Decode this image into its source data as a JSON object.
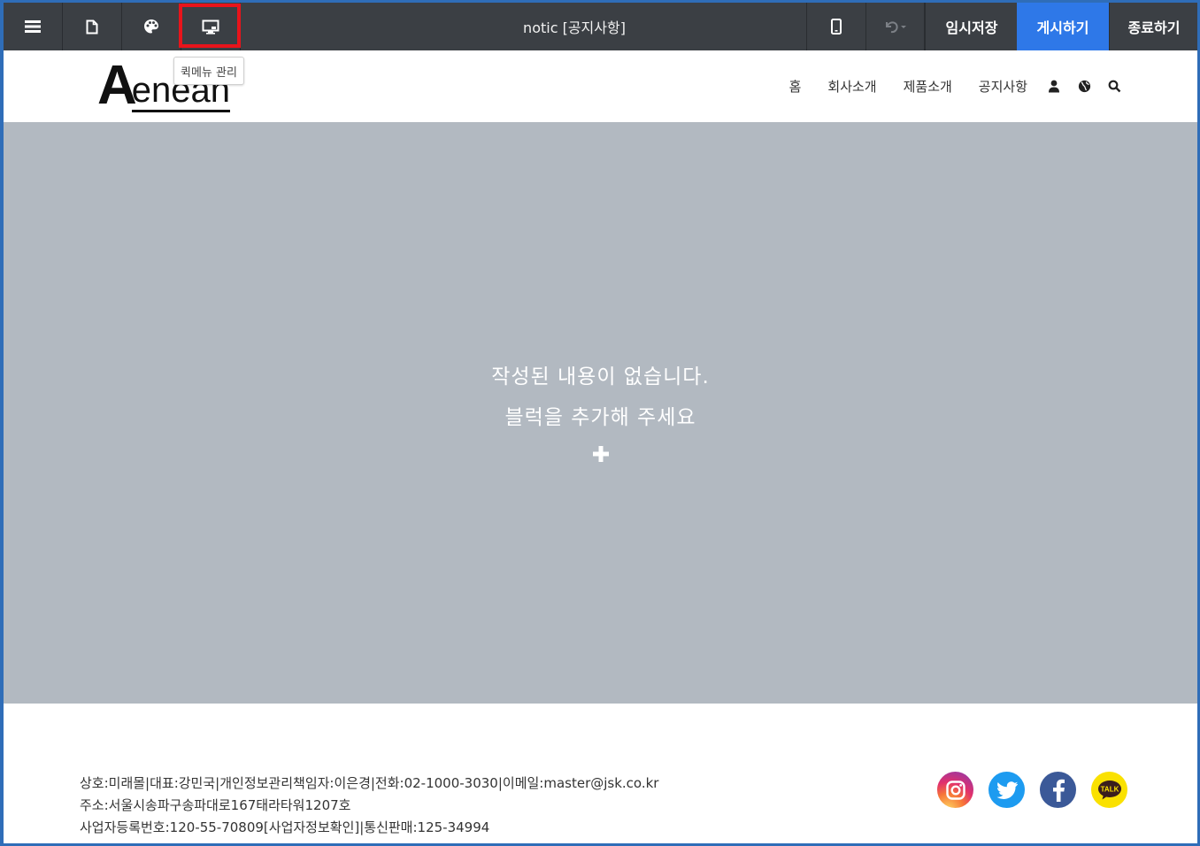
{
  "toolbar": {
    "title": "notic [공지사항]",
    "temp_save": "임시저장",
    "publish": "게시하기",
    "exit": "종료하기",
    "icons": [
      "menu-icon",
      "page-icon",
      "palette-icon",
      "desktop-icon",
      "mobile-icon",
      "undo-icon"
    ],
    "colors": {
      "bar": "#3b3f44",
      "publish": "#2e78e8",
      "highlight": "#e8141b"
    }
  },
  "tooltip": {
    "text": "퀵메뉴 관리"
  },
  "site": {
    "logo_first": "A",
    "logo_rest": "enean",
    "nav": [
      "홈",
      "회사소개",
      "제품소개",
      "공지사항"
    ],
    "nav_icons": [
      "user-icon",
      "globe-icon",
      "search-icon"
    ]
  },
  "content": {
    "message1": "작성된 내용이 없습니다.",
    "message2": "블럭을 추가해 주세요",
    "bg_color": "#b2b9c1"
  },
  "footer": {
    "line1": "상호:미래몰|대표:강민국|개인정보관리책임자:이은경|전화:02-1000-3030|이메일:master@jsk.co.kr",
    "line2": "주소:서울시송파구송파대로167태라타워1207호",
    "line3": "사업자등록번호:120-55-70809[사업자정보확인]|통신판매:125-34994",
    "social": [
      "instagram-icon",
      "twitter-icon",
      "facebook-icon",
      "kakaotalk-icon"
    ],
    "social_label_talk": "TALK"
  }
}
